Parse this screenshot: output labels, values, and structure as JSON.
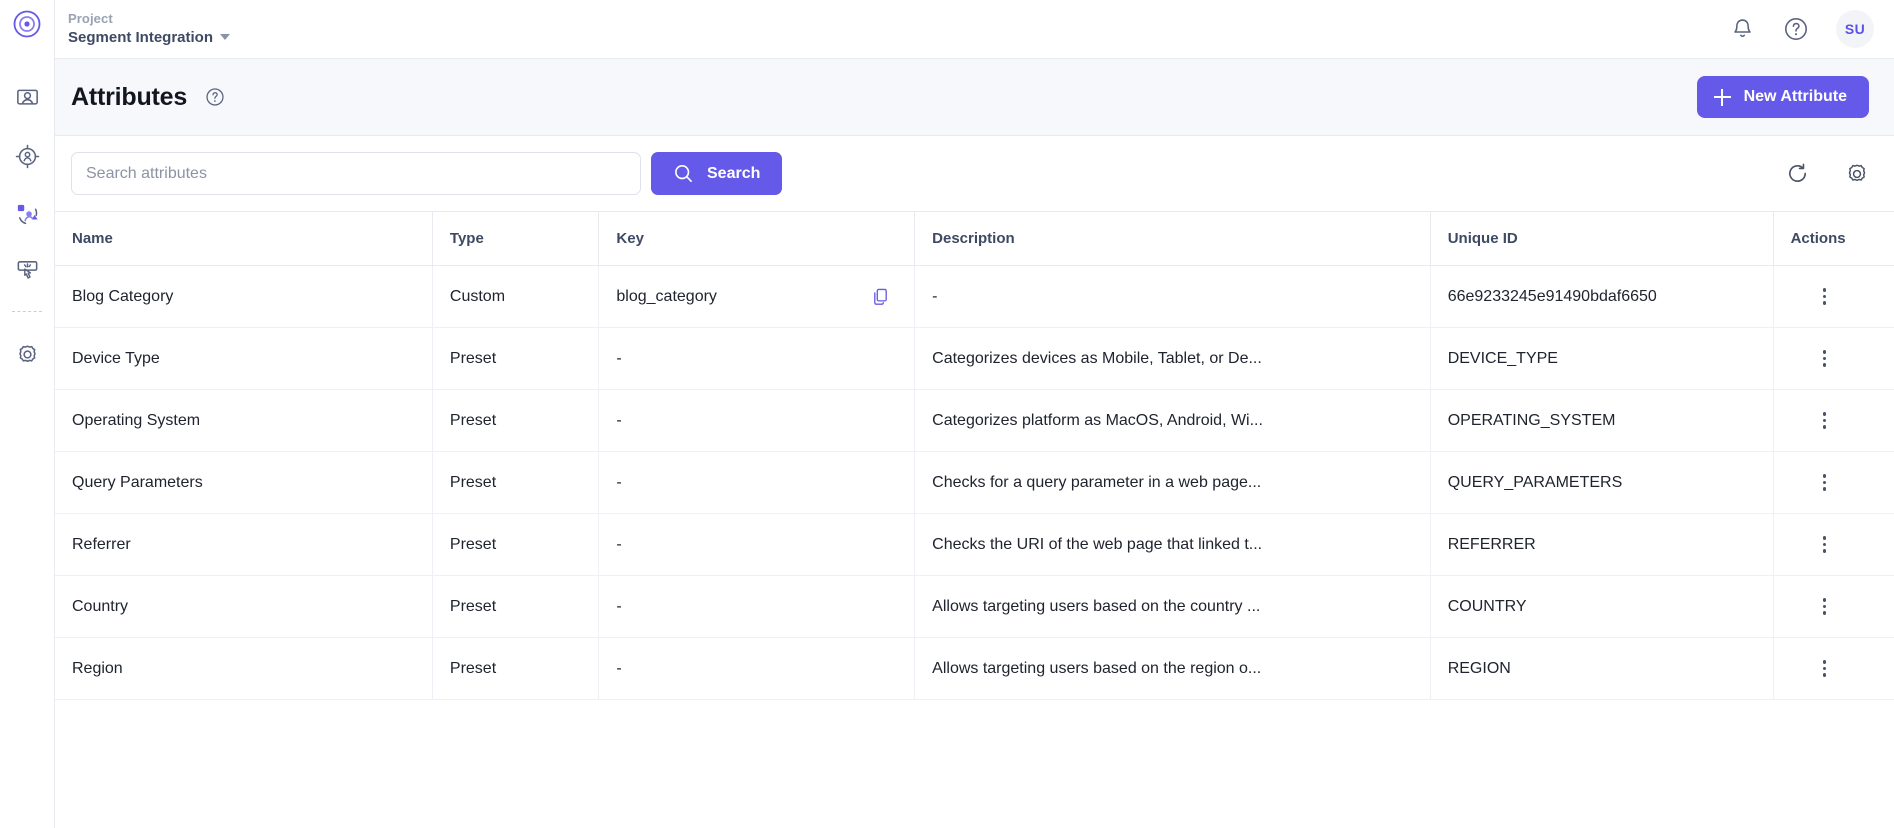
{
  "sidebar": {
    "logo_icon": "target-logo-icon",
    "items": [
      {
        "icon": "audience-screen-icon",
        "name": "audiences"
      },
      {
        "icon": "target-user-icon",
        "name": "targeting"
      },
      {
        "icon": "segments-users-icon",
        "name": "segments"
      },
      {
        "icon": "click-interaction-icon",
        "name": "experiences"
      }
    ],
    "footer_items": [
      {
        "icon": "gear-icon",
        "name": "settings"
      }
    ]
  },
  "topbar": {
    "project_label": "Project",
    "project_name": "Segment Integration",
    "caret_icon": "chevron-down-icon",
    "notifications_icon": "bell-icon",
    "help_icon": "question-circle-icon",
    "avatar_initials": "SU"
  },
  "page": {
    "title": "Attributes",
    "title_help_icon": "question-circle-icon",
    "new_attribute_label": "New Attribute",
    "new_attribute_icon": "plus-icon"
  },
  "search": {
    "placeholder": "Search attributes",
    "value": "",
    "button_label": "Search",
    "button_icon": "search-icon",
    "refresh_icon": "refresh-icon",
    "settings_icon": "gear-icon"
  },
  "table": {
    "columns": [
      "Name",
      "Type",
      "Key",
      "Description",
      "Unique ID",
      "Actions"
    ],
    "rows": [
      {
        "name": "Blog Category",
        "type": "Custom",
        "key": "blog_category",
        "has_copy": true,
        "description": "-",
        "unique_id": "66e9233245e91490bdaf6650"
      },
      {
        "name": "Device Type",
        "type": "Preset",
        "key": "-",
        "has_copy": false,
        "description": "Categorizes devices as Mobile, Tablet, or De...",
        "unique_id": "DEVICE_TYPE"
      },
      {
        "name": "Operating System",
        "type": "Preset",
        "key": "-",
        "has_copy": false,
        "description": "Categorizes platform as MacOS, Android, Wi...",
        "unique_id": "OPERATING_SYSTEM"
      },
      {
        "name": "Query Parameters",
        "type": "Preset",
        "key": "-",
        "has_copy": false,
        "description": "Checks for a query parameter in a web page...",
        "unique_id": "QUERY_PARAMETERS"
      },
      {
        "name": "Referrer",
        "type": "Preset",
        "key": "-",
        "has_copy": false,
        "description": "Checks the URI of the web page that linked t...",
        "unique_id": "REFERRER"
      },
      {
        "name": "Country",
        "type": "Preset",
        "key": "-",
        "has_copy": false,
        "description": "Allows targeting users based on the country ...",
        "unique_id": "COUNTRY"
      },
      {
        "name": "Region",
        "type": "Preset",
        "key": "-",
        "has_copy": false,
        "description": "Allows targeting users based on the region o...",
        "unique_id": "REGION"
      }
    ],
    "row_action_icon": "kebab-menu-icon",
    "copy_icon": "copy-icon"
  },
  "colors": {
    "accent": "#6459e8",
    "header_band": "#f7f8fc",
    "text": "#20242e",
    "muted": "#8d93a5"
  }
}
